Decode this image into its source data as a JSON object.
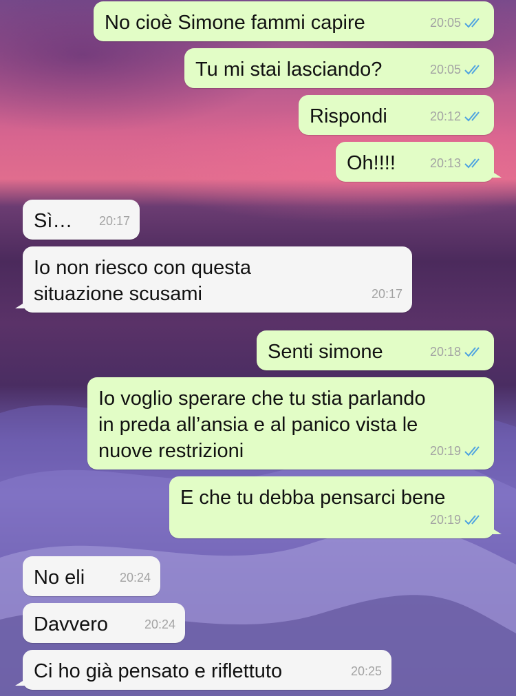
{
  "messages": [
    {
      "text": "No cioè Simone fammi capire",
      "time": "20:05"
    },
    {
      "text": "Tu mi stai lasciando?",
      "time": "20:05"
    },
    {
      "text": "Rispondi",
      "time": "20:12"
    },
    {
      "text": "Oh!!!!",
      "time": "20:13"
    },
    {
      "text": "Sì…",
      "time": "20:17"
    },
    {
      "text": "Io non riesco con questa\nsituazione scusami",
      "time": "20:17"
    },
    {
      "text": "Senti simone",
      "time": "20:18"
    },
    {
      "text": "Io voglio sperare che tu stia parlando\nin preda all’ansia e al panico vista le\nnuove restrizioni",
      "time": "20:19"
    },
    {
      "text": "E che tu debba pensarci bene",
      "time": "20:19"
    },
    {
      "text": "No eli",
      "time": "20:24"
    },
    {
      "text": "Davvero",
      "time": "20:24"
    },
    {
      "text": "Ci ho già pensato e riflettuto",
      "time": "20:25"
    }
  ],
  "colors": {
    "outgoing_bubble": "#e2fdc6",
    "incoming_bubble": "#f5f5f5",
    "read_ticks": "#4fa3e0",
    "timestamp": "#a3a3a3"
  },
  "icons": {
    "read_status": "double-check-icon"
  }
}
